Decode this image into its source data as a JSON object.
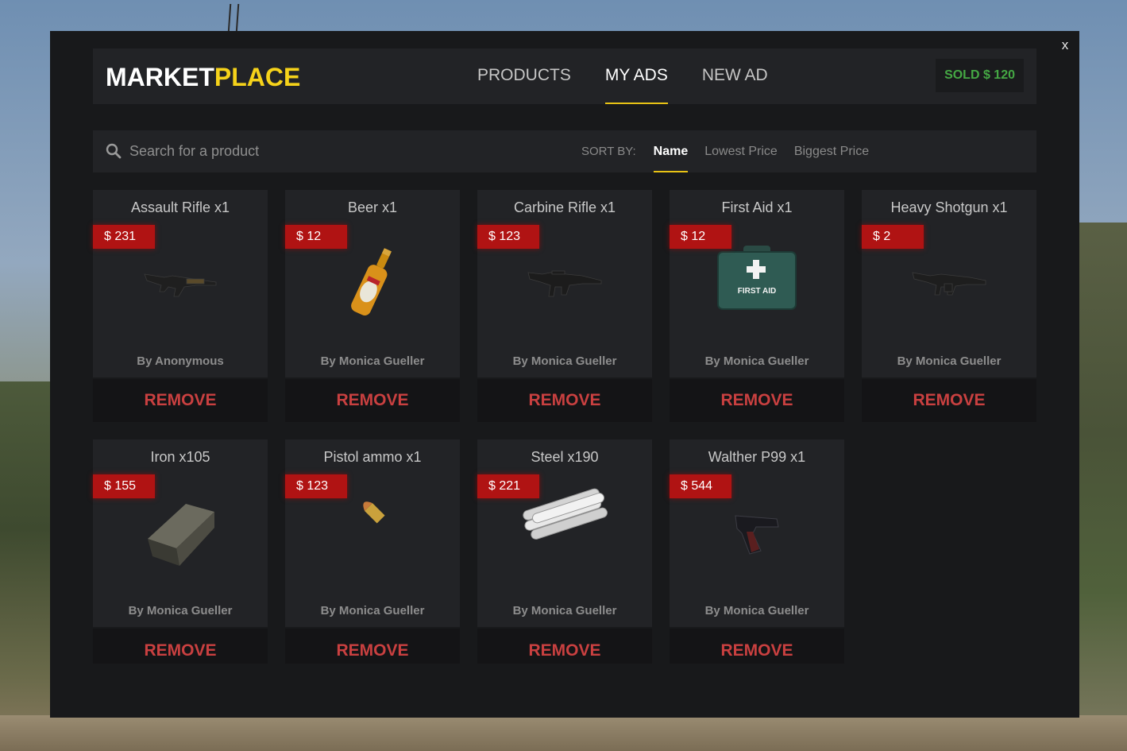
{
  "close_label": "x",
  "logo": {
    "part1": "MARKET",
    "part2": "PLACE"
  },
  "nav": {
    "tabs": [
      {
        "label": "PRODUCTS"
      },
      {
        "label": "MY ADS"
      },
      {
        "label": "NEW AD"
      }
    ],
    "active": "MY ADS"
  },
  "sold": "SOLD $ 120",
  "search": {
    "placeholder": "Search for a product",
    "value": ""
  },
  "sort": {
    "label": "SORT BY:",
    "options": [
      "Name",
      "Lowest Price",
      "Biggest Price"
    ],
    "active": "Name"
  },
  "remove_label": "REMOVE",
  "items": [
    {
      "title": "Assault Rifle x1",
      "price": "$ 231",
      "seller": "By Anonymous",
      "icon": "assault-rifle-icon"
    },
    {
      "title": "Beer x1",
      "price": "$ 12",
      "seller": "By Monica Gueller",
      "icon": "beer-bottle-icon"
    },
    {
      "title": "Carbine Rifle x1",
      "price": "$ 123",
      "seller": "By Monica Gueller",
      "icon": "carbine-rifle-icon"
    },
    {
      "title": "First Aid x1",
      "price": "$ 12",
      "seller": "By Monica Gueller",
      "icon": "first-aid-kit-icon",
      "icon_text": "FIRST AID"
    },
    {
      "title": "Heavy Shotgun x1",
      "price": "$ 2",
      "seller": "By Monica Gueller",
      "icon": "heavy-shotgun-icon"
    },
    {
      "title": "Iron x105",
      "price": "$ 155",
      "seller": "By Monica Gueller",
      "icon": "iron-ingot-icon"
    },
    {
      "title": "Pistol ammo x1",
      "price": "$ 123",
      "seller": "By Monica Gueller",
      "icon": "bullet-icon"
    },
    {
      "title": "Steel x190",
      "price": "$ 221",
      "seller": "By Monica Gueller",
      "icon": "steel-bars-icon"
    },
    {
      "title": "Walther P99 x1",
      "price": "$ 544",
      "seller": "By Monica Gueller",
      "icon": "pistol-icon"
    }
  ],
  "colors": {
    "accent": "#f5d21a",
    "price": "#b01313",
    "remove": "#c94040",
    "sold": "#45a844"
  }
}
